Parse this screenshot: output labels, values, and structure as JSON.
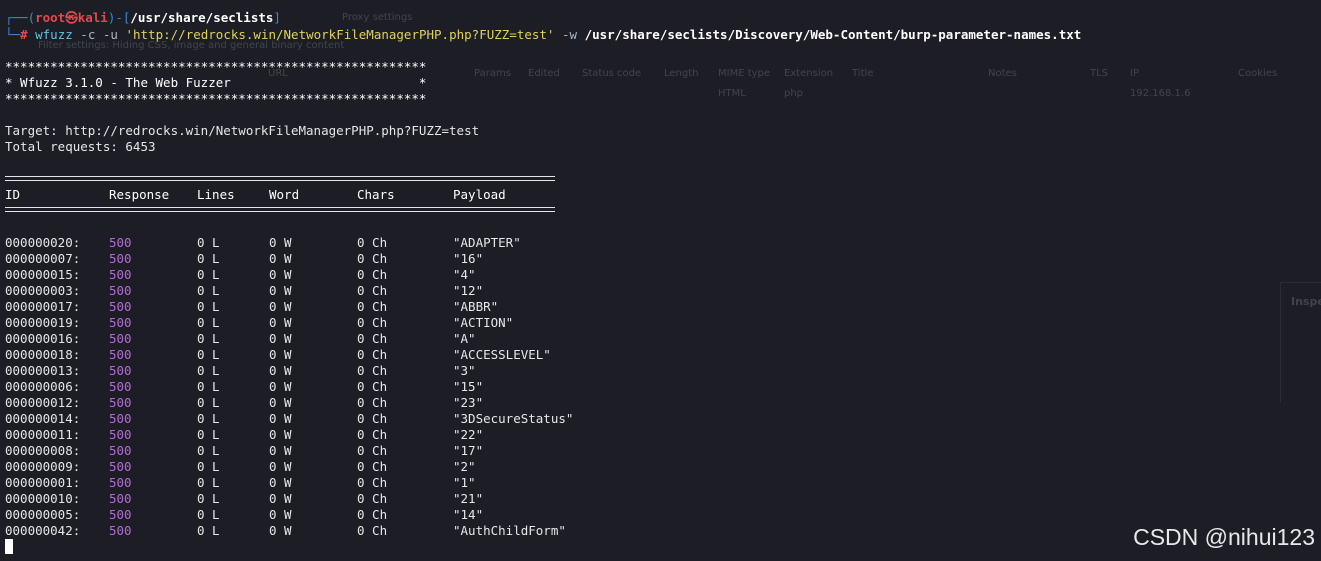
{
  "prompt": {
    "corner_top": "┌──(",
    "user": "root㉿kali",
    "mid": ")-[",
    "path": "/usr/share/seclists",
    "end": "]",
    "corner_bottom": "└─",
    "hash": "#"
  },
  "command": {
    "tool": "wfuzz",
    "flag_c": "-c",
    "flag_u": "-u",
    "url": "'http://redrocks.win/NetworkFileManagerPHP.php?FUZZ=test'",
    "flag_w": "-w",
    "wordlist": "/usr/share/seclists/Discovery/Web-Content/burp-parameter-names.txt"
  },
  "banner": {
    "border": "********************************************************",
    "title": "* Wfuzz 3.1.0 - The Web Fuzzer                         *"
  },
  "target": {
    "target_line": "Target: http://redrocks.win/NetworkFileManagerPHP.php?FUZZ=test",
    "total_line": "Total requests: 6453"
  },
  "table": {
    "headers": {
      "id": "ID",
      "response": "Response",
      "lines": "Lines",
      "word": "Word",
      "chars": "Chars",
      "payload": "Payload"
    },
    "rows": [
      {
        "id": "000000020:",
        "response": "500",
        "lines": "0 L",
        "word": "0 W",
        "chars": "0 Ch",
        "payload": "\"ADAPTER\""
      },
      {
        "id": "000000007:",
        "response": "500",
        "lines": "0 L",
        "word": "0 W",
        "chars": "0 Ch",
        "payload": "\"16\""
      },
      {
        "id": "000000015:",
        "response": "500",
        "lines": "0 L",
        "word": "0 W",
        "chars": "0 Ch",
        "payload": "\"4\""
      },
      {
        "id": "000000003:",
        "response": "500",
        "lines": "0 L",
        "word": "0 W",
        "chars": "0 Ch",
        "payload": "\"12\""
      },
      {
        "id": "000000017:",
        "response": "500",
        "lines": "0 L",
        "word": "0 W",
        "chars": "0 Ch",
        "payload": "\"ABBR\""
      },
      {
        "id": "000000019:",
        "response": "500",
        "lines": "0 L",
        "word": "0 W",
        "chars": "0 Ch",
        "payload": "\"ACTION\""
      },
      {
        "id": "000000016:",
        "response": "500",
        "lines": "0 L",
        "word": "0 W",
        "chars": "0 Ch",
        "payload": "\"A\""
      },
      {
        "id": "000000018:",
        "response": "500",
        "lines": "0 L",
        "word": "0 W",
        "chars": "0 Ch",
        "payload": "\"ACCESSLEVEL\""
      },
      {
        "id": "000000013:",
        "response": "500",
        "lines": "0 L",
        "word": "0 W",
        "chars": "0 Ch",
        "payload": "\"3\""
      },
      {
        "id": "000000006:",
        "response": "500",
        "lines": "0 L",
        "word": "0 W",
        "chars": "0 Ch",
        "payload": "\"15\""
      },
      {
        "id": "000000012:",
        "response": "500",
        "lines": "0 L",
        "word": "0 W",
        "chars": "0 Ch",
        "payload": "\"23\""
      },
      {
        "id": "000000014:",
        "response": "500",
        "lines": "0 L",
        "word": "0 W",
        "chars": "0 Ch",
        "payload": "\"3DSecureStatus\""
      },
      {
        "id": "000000011:",
        "response": "500",
        "lines": "0 L",
        "word": "0 W",
        "chars": "0 Ch",
        "payload": "\"22\""
      },
      {
        "id": "000000008:",
        "response": "500",
        "lines": "0 L",
        "word": "0 W",
        "chars": "0 Ch",
        "payload": "\"17\""
      },
      {
        "id": "000000009:",
        "response": "500",
        "lines": "0 L",
        "word": "0 W",
        "chars": "0 Ch",
        "payload": "\"2\""
      },
      {
        "id": "000000001:",
        "response": "500",
        "lines": "0 L",
        "word": "0 W",
        "chars": "0 Ch",
        "payload": "\"1\""
      },
      {
        "id": "000000010:",
        "response": "500",
        "lines": "0 L",
        "word": "0 W",
        "chars": "0 Ch",
        "payload": "\"21\""
      },
      {
        "id": "000000005:",
        "response": "500",
        "lines": "0 L",
        "word": "0 W",
        "chars": "0 Ch",
        "payload": "\"14\""
      },
      {
        "id": "000000042:",
        "response": "500",
        "lines": "0 L",
        "word": "0 W",
        "chars": "0 Ch",
        "payload": "\"AuthChildForm\""
      }
    ]
  },
  "ghost": {
    "proxy_settings": "Proxy settings",
    "filter_text": "Filter settings: Hiding CSS, image and general binary content",
    "columns": [
      "URL",
      "Params",
      "Edited",
      "Status code",
      "Length",
      "MIME type",
      "Extension",
      "Title",
      "Notes",
      "TLS",
      "IP",
      "Cookies"
    ],
    "mime": "HTML",
    "ext": "php",
    "ip": "192.168.1.6",
    "inspector": "Inspe"
  },
  "watermark": "CSDN @nihui123",
  "colors": {
    "background": "#1d1e25",
    "prompt_blue": "#3c83e6",
    "prompt_red": "#e5484d",
    "command_cyan": "#5ec4e6",
    "string_yellow": "#e0d25b",
    "response_purple": "#b46ad6"
  }
}
